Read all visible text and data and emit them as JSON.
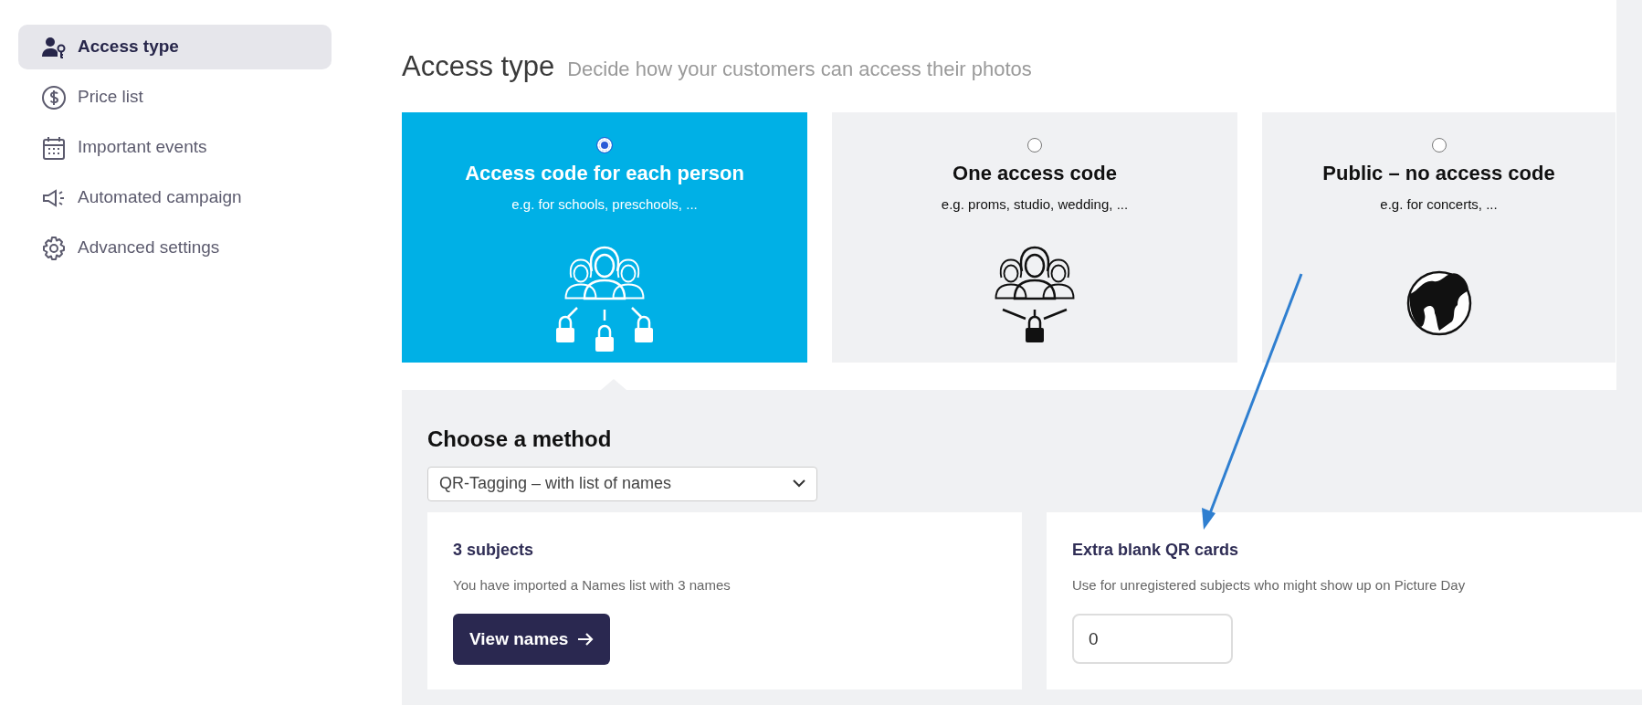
{
  "sidebar": {
    "items": [
      {
        "label": "Access type",
        "selected": true
      },
      {
        "label": "Price list",
        "selected": false
      },
      {
        "label": "Important events",
        "selected": false
      },
      {
        "label": "Automated campaign",
        "selected": false
      },
      {
        "label": "Advanced settings",
        "selected": false
      }
    ]
  },
  "header": {
    "title": "Access type",
    "subtitle": "Decide how your customers can access their photos"
  },
  "access_options": [
    {
      "title": "Access code for each person",
      "description": "e.g. for schools, preschools, ...",
      "selected": true
    },
    {
      "title": "One access code",
      "description": "e.g. proms, studio, wedding, ...",
      "selected": false
    },
    {
      "title": "Public – no access code",
      "description": "e.g. for concerts, ...",
      "selected": false
    }
  ],
  "method": {
    "heading": "Choose a method",
    "value": "QR-Tagging – with list of names"
  },
  "subjects_card": {
    "title": "3 subjects",
    "text": "You have imported a Names list with 3 names",
    "button": "View names"
  },
  "qr_card": {
    "title": "Extra blank QR cards",
    "text": "Use for unregistered subjects who might show up on Picture Day",
    "value": "0"
  }
}
